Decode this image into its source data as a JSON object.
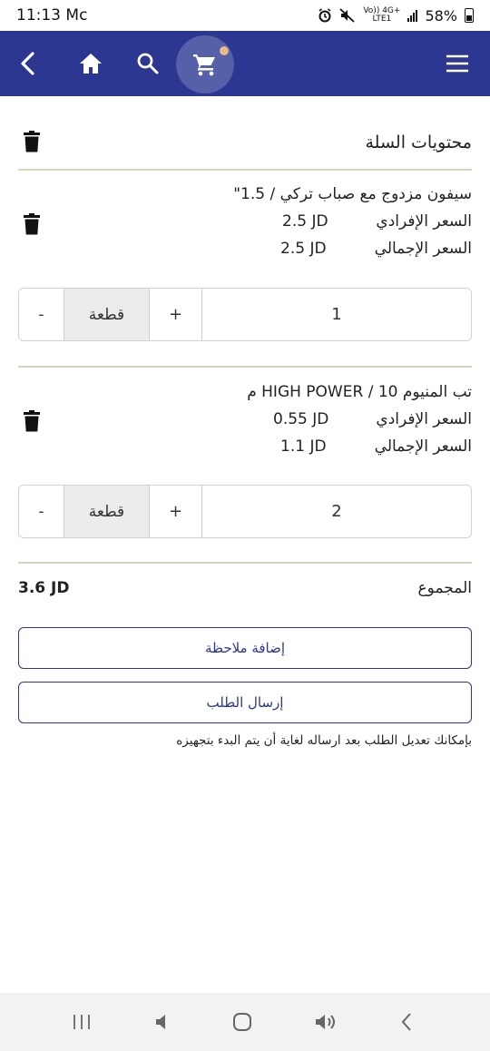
{
  "status_bar": {
    "time": "11:13 Mc",
    "network_top": "Vo)) 4G+",
    "network_bottom": "LTE1",
    "battery": "58%"
  },
  "app_bar": {
    "icons": [
      "back-arrow-icon",
      "home-icon",
      "search-icon",
      "cart-icon",
      "menu-icon"
    ],
    "colors": {
      "background": "#2b3790",
      "cart_highlight": "#5560a9",
      "cart_badge": "#e8b98a"
    }
  },
  "cart": {
    "title": "محتويات السلة",
    "items": [
      {
        "name": "سيفون مزدوج مع صباب تركي / 1.5\"",
        "unit_price_label": "السعر الإفرادي",
        "unit_price": "2.5 JD",
        "total_price_label": "السعر الإجمالي",
        "total_price": "2.5 JD",
        "minus": "-",
        "unit": "قطعة",
        "plus": "+",
        "quantity": "1"
      },
      {
        "name": "تب المنيوم HIGH POWER / 10 م",
        "unit_price_label": "السعر الإفرادي",
        "unit_price": "0.55 JD",
        "total_price_label": "السعر الإجمالي",
        "total_price": "1.1 JD",
        "minus": "-",
        "unit": "قطعة",
        "plus": "+",
        "quantity": "2"
      }
    ],
    "total_label": "المجموع",
    "total_value": "3.6 JD",
    "add_note_button": "إضافة ملاحظة",
    "submit_button": "إرسال الطلب",
    "edit_note": "بإمكانك تعديل الطلب بعد ارساله لغاية أن يتم البدء بتجهيزه"
  }
}
